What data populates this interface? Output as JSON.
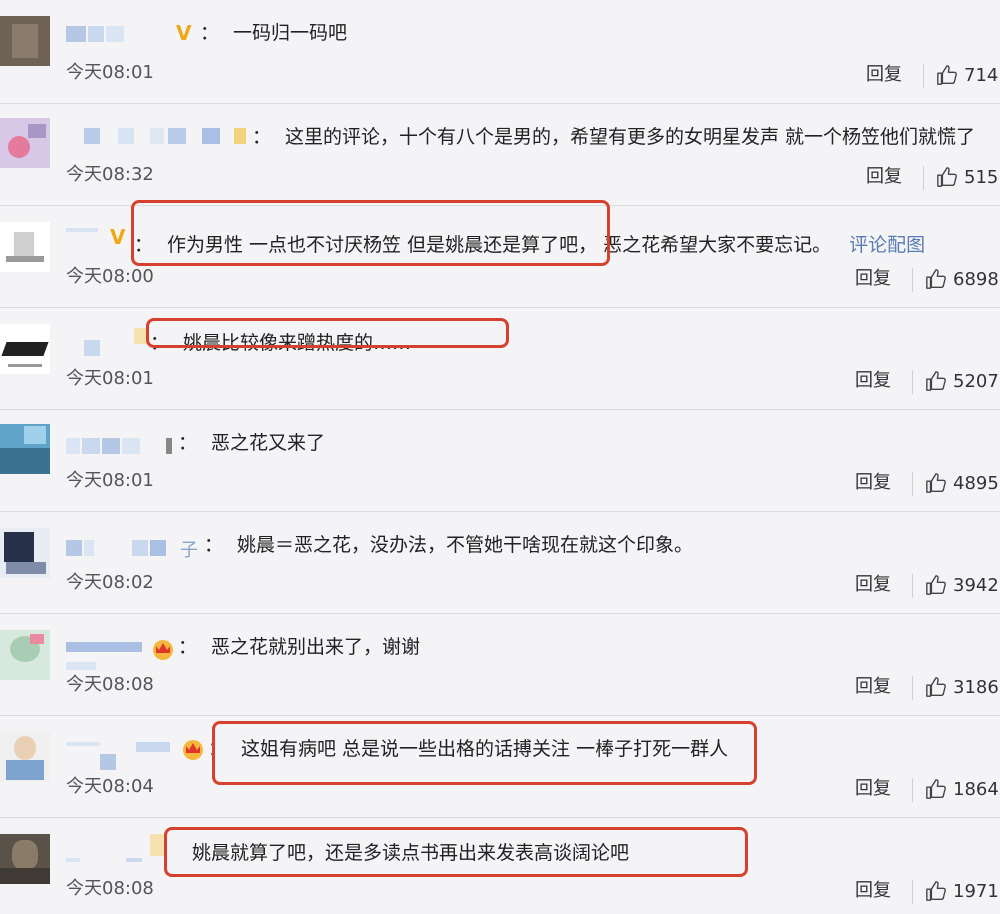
{
  "reply_label": "回复",
  "accent_color": "#d8402e",
  "comments": [
    {
      "badge": "V",
      "text": "一码归一码吧",
      "time": "今天08:01",
      "likes": "714"
    },
    {
      "badge": "",
      "text": "这里的评论，十个有八个是男的，希望有更多的女明星发声 就一个杨笠他们就慌了",
      "time": "今天08:32",
      "likes": "515"
    },
    {
      "badge": "V",
      "text": "作为男性 一点也不讨厌杨笠 但是姚晨还是算了吧，  恶之花希望大家不要忘记。",
      "link": "评论配图",
      "time": "今天08:00",
      "likes": "6898"
    },
    {
      "badge": "",
      "text": "姚晨比较像来蹭热度的……",
      "time": "今天08:01",
      "likes": "5207"
    },
    {
      "badge": "",
      "text": "恶之花又来了",
      "time": "今天08:01",
      "likes": "4895"
    },
    {
      "badge": "",
      "name_tail": "子",
      "text": "姚晨＝恶之花，没办法，不管她干啥现在就这个印象。",
      "time": "今天08:02",
      "likes": "3942"
    },
    {
      "badge": "crown",
      "text": "恶之花就别出来了，谢谢",
      "time": "今天08:08",
      "likes": "3186"
    },
    {
      "badge": "crown",
      "text": "这姐有病吧 总是说一些出格的话搏关注 一棒子打死一群人",
      "time": "今天08:04",
      "likes": "1864"
    },
    {
      "badge": "",
      "text": "姚晨就算了吧，还是多读点书再出来发表高谈阔论吧",
      "time": "今天08:08",
      "likes": "1971"
    }
  ]
}
